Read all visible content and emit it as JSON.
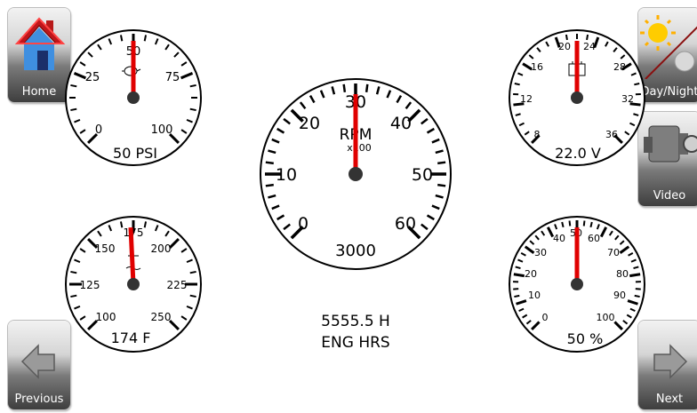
{
  "buttons": {
    "home": "Home",
    "day_night": "Day/Night",
    "video": "Video",
    "previous": "Previous",
    "next": "Next"
  },
  "engine_hours": {
    "value": "5555.5 H",
    "label": "ENG HRS"
  },
  "gauges": {
    "oil_pressure": {
      "ticks": [
        "0",
        "25",
        "50",
        "75",
        "100"
      ],
      "readout": "50 PSI",
      "level": 0.5
    },
    "temperature": {
      "ticks": [
        "100",
        "125",
        "150",
        "175",
        "200",
        "225",
        "250"
      ],
      "readout": "174 F",
      "level": 0.49
    },
    "rpm": {
      "ticks": [
        "0",
        "10",
        "20",
        "30",
        "40",
        "50",
        "60"
      ],
      "title": "RPM",
      "multiplier": "x100",
      "readout": "3000",
      "level": 0.5
    },
    "voltage": {
      "ticks": [
        "8",
        "12",
        "16",
        "20",
        "24",
        "28",
        "32",
        "36"
      ],
      "readout": "22.0 V",
      "level": 0.5
    },
    "percent": {
      "ticks": [
        "0",
        "10",
        "20",
        "30",
        "40",
        "50",
        "60",
        "70",
        "80",
        "90",
        "100"
      ],
      "readout": "50 %",
      "level": 0.5
    }
  },
  "icons": {
    "oil": "oil-can-icon",
    "coolant": "coolant-temp-icon",
    "battery": "battery-icon"
  }
}
